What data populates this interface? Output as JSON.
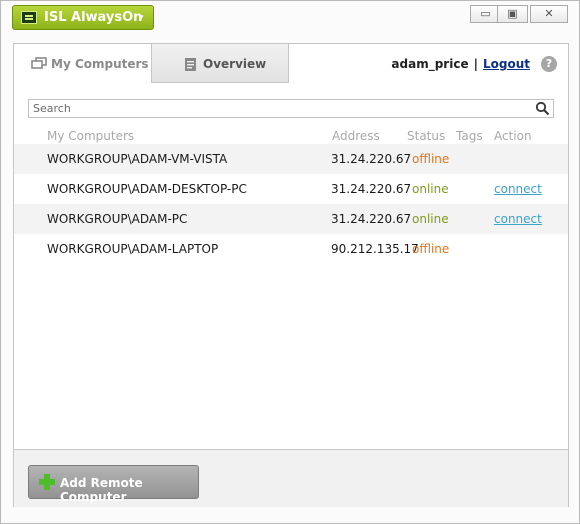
{
  "app": {
    "title": "ISL AlwaysOn",
    "caret": "▾"
  },
  "window_controls": {
    "minimize": "▭",
    "restore": "▣",
    "close": "✕"
  },
  "tabs": [
    {
      "label": "My Computers",
      "icon": "computers-icon",
      "active": true
    },
    {
      "label": "Overview",
      "icon": "document-icon",
      "active": false
    }
  ],
  "user": {
    "name": "adam_price",
    "separator": "|",
    "logout": "Logout"
  },
  "help": {
    "label": "?"
  },
  "search": {
    "placeholder": "Search"
  },
  "table": {
    "columns": [
      "My Computers",
      "Address",
      "Status",
      "Tags",
      "Action"
    ],
    "rows": [
      {
        "name": "WORKGROUP\\ADAM-VM-VISTA",
        "address": "31.24.220.67",
        "status": "offline",
        "action": ""
      },
      {
        "name": "WORKGROUP\\ADAM-DESKTOP-PC",
        "address": "31.24.220.67",
        "status": "online",
        "action": "connect"
      },
      {
        "name": "WORKGROUP\\ADAM-PC",
        "address": "31.24.220.67",
        "status": "online",
        "action": "connect"
      },
      {
        "name": "WORKGROUP\\ADAM-LAPTOP",
        "address": "90.212.135.17",
        "status": "offline",
        "action": ""
      }
    ]
  },
  "footer": {
    "add_button": "Add Remote Computer"
  },
  "colors": {
    "accent_green": "#9bc11f",
    "offline": "#e2751f",
    "online": "#7e9b1a",
    "link": "#3aa3c8"
  }
}
